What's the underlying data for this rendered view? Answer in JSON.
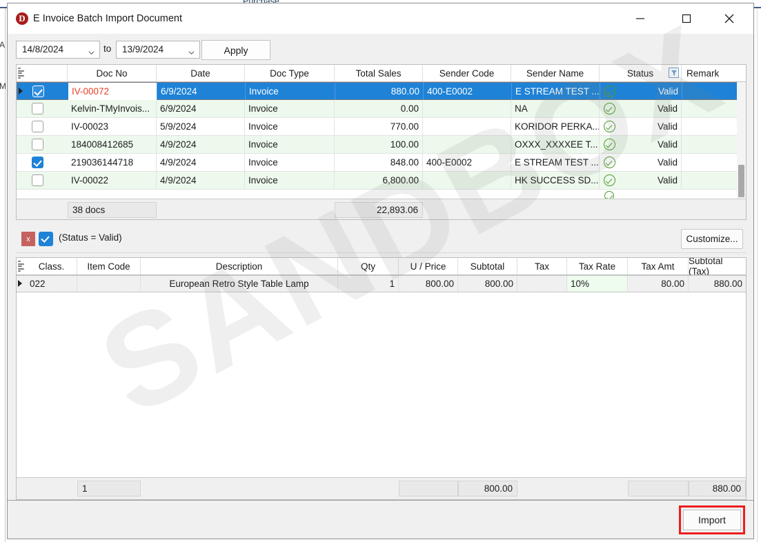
{
  "background_app": {
    "label": "Purchase",
    "left_letter_1": "A",
    "left_letter_2": "M"
  },
  "window": {
    "title": "E Invoice Batch Import Document",
    "icon": "app-logo-d",
    "minimize_label": "Minimize",
    "maximize_label": "Maximize",
    "close_label": "Close"
  },
  "watermark": {
    "text": "SANDBOX"
  },
  "toolbar": {
    "date_from": "14/8/2024",
    "date_to": "13/9/2024",
    "to_label": "to",
    "apply_label": "Apply"
  },
  "master_grid": {
    "columns": [
      {
        "key": "check",
        "label": ""
      },
      {
        "key": "doc_no",
        "label": "Doc No"
      },
      {
        "key": "date",
        "label": "Date"
      },
      {
        "key": "doc_type",
        "label": "Doc Type"
      },
      {
        "key": "total_sales",
        "label": "Total Sales"
      },
      {
        "key": "sender_code",
        "label": "Sender Code"
      },
      {
        "key": "sender_name",
        "label": "Sender Name"
      },
      {
        "key": "status",
        "label": "Status"
      },
      {
        "key": "remark",
        "label": "Remark"
      }
    ],
    "filter_icon": "filter-icon",
    "rows": [
      {
        "checked": true,
        "selected": true,
        "doc_no": "IV-00072",
        "date": "6/9/2024",
        "doc_type": "Invoice",
        "total_sales": "880.00",
        "sender_code": "400-E0002",
        "sender_name": "E STREAM TEST ...",
        "status": "Valid",
        "remark": ""
      },
      {
        "checked": false,
        "selected": false,
        "doc_no": "Kelvin-TMyInvois...",
        "date": "6/9/2024",
        "doc_type": "Invoice",
        "total_sales": "0.00",
        "sender_code": "",
        "sender_name": "NA",
        "status": "Valid",
        "remark": ""
      },
      {
        "checked": false,
        "selected": false,
        "doc_no": "IV-00023",
        "date": "5/9/2024",
        "doc_type": "Invoice",
        "total_sales": "770.00",
        "sender_code": "",
        "sender_name": "KORIDOR PERKA...",
        "status": "Valid",
        "remark": ""
      },
      {
        "checked": false,
        "selected": false,
        "doc_no": "184008412685",
        "date": "4/9/2024",
        "doc_type": "Invoice",
        "total_sales": "100.00",
        "sender_code": "",
        "sender_name": "OXXX_XXXXEE T...",
        "status": "Valid",
        "remark": ""
      },
      {
        "checked": true,
        "selected": false,
        "doc_no": "219036144718",
        "date": "4/9/2024",
        "doc_type": "Invoice",
        "total_sales": "848.00",
        "sender_code": "400-E0002",
        "sender_name": "E STREAM TEST ...",
        "status": "Valid",
        "remark": ""
      },
      {
        "checked": false,
        "selected": false,
        "doc_no": "IV-00022",
        "date": "4/9/2024",
        "doc_type": "Invoice",
        "total_sales": "6,800.00",
        "sender_code": "",
        "sender_name": "HK SUCCESS SD...",
        "status": "Valid",
        "remark": ""
      }
    ],
    "summary": {
      "doc_count": "38 docs",
      "total_sales": "22,893.06"
    }
  },
  "filter_bar": {
    "close_label": "x",
    "expression": "(Status = Valid)",
    "customize_label": "Customize..."
  },
  "detail_grid": {
    "columns": [
      {
        "key": "class",
        "label": "Class."
      },
      {
        "key": "item_code",
        "label": "Item Code"
      },
      {
        "key": "description",
        "label": "Description"
      },
      {
        "key": "qty",
        "label": "Qty"
      },
      {
        "key": "unit_price",
        "label": "U / Price"
      },
      {
        "key": "subtotal",
        "label": "Subtotal"
      },
      {
        "key": "tax",
        "label": "Tax"
      },
      {
        "key": "tax_rate",
        "label": "Tax Rate"
      },
      {
        "key": "tax_amt",
        "label": "Tax Amt"
      },
      {
        "key": "subtotal_tax",
        "label": "Subtotal (Tax)"
      }
    ],
    "rows": [
      {
        "class": "022",
        "item_code": "",
        "description": "European Retro Style Table Lamp",
        "qty": "1",
        "unit_price": "800.00",
        "subtotal": "800.00",
        "tax": "",
        "tax_rate": "10%",
        "tax_amt": "80.00",
        "subtotal_tax": "880.00"
      }
    ],
    "summary": {
      "qty": "1",
      "subtotal": "800.00",
      "subtotal_tax": "880.00"
    }
  },
  "footer": {
    "import_label": "Import"
  },
  "colors": {
    "selection_blue": "#1e82d7",
    "alt_row_green": "#edf9ed",
    "valid_green": "#4d9a28",
    "doc_no_red": "#e23b26",
    "highlight_red": "#ee1c1c",
    "filter_close_red": "#c4625f"
  }
}
